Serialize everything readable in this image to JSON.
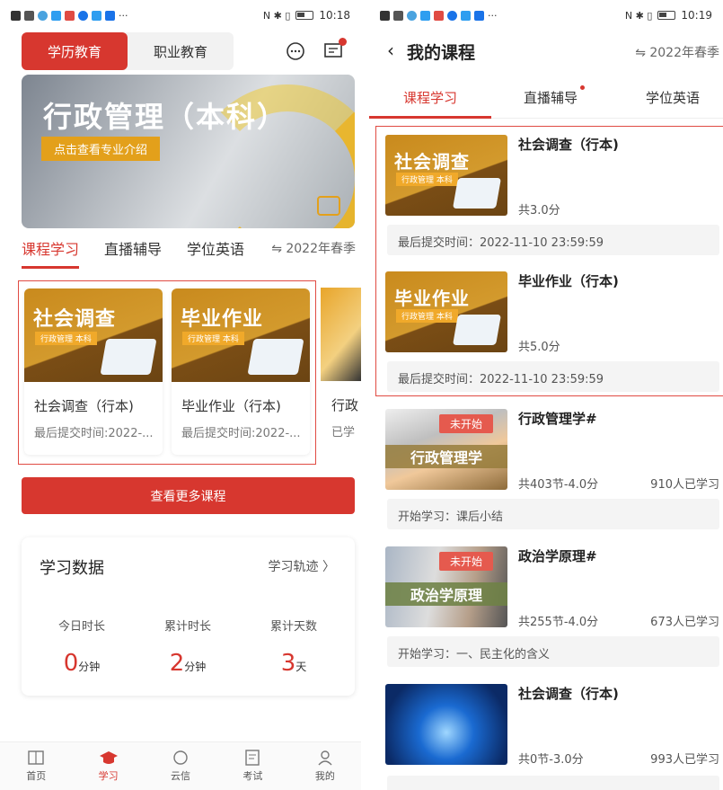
{
  "left": {
    "status": {
      "time": "10:18"
    },
    "segments": [
      "学历教育",
      "职业教育"
    ],
    "banner": {
      "title": "行政管理（本科）",
      "button": "点击查看专业介绍"
    },
    "tabs": [
      "课程学习",
      "直播辅导",
      "学位英语"
    ],
    "season": "⇋ 2022年春季",
    "cards": [
      {
        "thumb_title": "社会调查",
        "thumb_sub": "行政管理 本科",
        "name": "社会调查（行本)",
        "time": "最后提交时间:2022-..."
      },
      {
        "thumb_title": "毕业作业",
        "thumb_sub": "行政管理 本科",
        "name": "毕业作业（行本)",
        "time": "最后提交时间:2022-..."
      },
      {
        "name": "行政",
        "time": "已学"
      }
    ],
    "more_button": "查看更多课程",
    "stats": {
      "title": "学习数据",
      "link": "学习轨迹 〉",
      "items": [
        {
          "label": "今日时长",
          "value": "0",
          "unit": "分钟"
        },
        {
          "label": "累计时长",
          "value": "2",
          "unit": "分钟"
        },
        {
          "label": "累计天数",
          "value": "3",
          "unit": "天"
        }
      ]
    },
    "nav": [
      "首页",
      "学习",
      "云信",
      "考试",
      "我的"
    ]
  },
  "right": {
    "status": {
      "time": "10:19"
    },
    "title": "我的课程",
    "season": "⇋ 2022年春季",
    "tabs": [
      "课程学习",
      "直播辅导",
      "学位英语"
    ],
    "items": [
      {
        "thumb_title": "社会调查",
        "thumb_sub": "行政管理 本科",
        "name": "社会调查（行本)",
        "meta": "共3.0分",
        "count": "",
        "foot": "最后提交时间：2022-11-10 23:59:59"
      },
      {
        "thumb_title": "毕业作业",
        "thumb_sub": "行政管理 本科",
        "name": "毕业作业（行本)",
        "meta": "共5.0分",
        "count": "",
        "foot": "最后提交时间：2022-11-10 23:59:59"
      },
      {
        "badge": "未开始",
        "strip": "行政管理学",
        "name": "行政管理学#",
        "meta": "共403节-4.0分",
        "count": "910人已学习",
        "foot": "开始学习：课后小结"
      },
      {
        "badge": "未开始",
        "strip": "政治学原理",
        "name": "政治学原理#",
        "meta": "共255节-4.0分",
        "count": "673人已学习",
        "foot": "开始学习：一、民主化的含义"
      },
      {
        "name": "社会调查（行本)",
        "meta": "共0节-3.0分",
        "count": "993人已学习"
      }
    ]
  }
}
